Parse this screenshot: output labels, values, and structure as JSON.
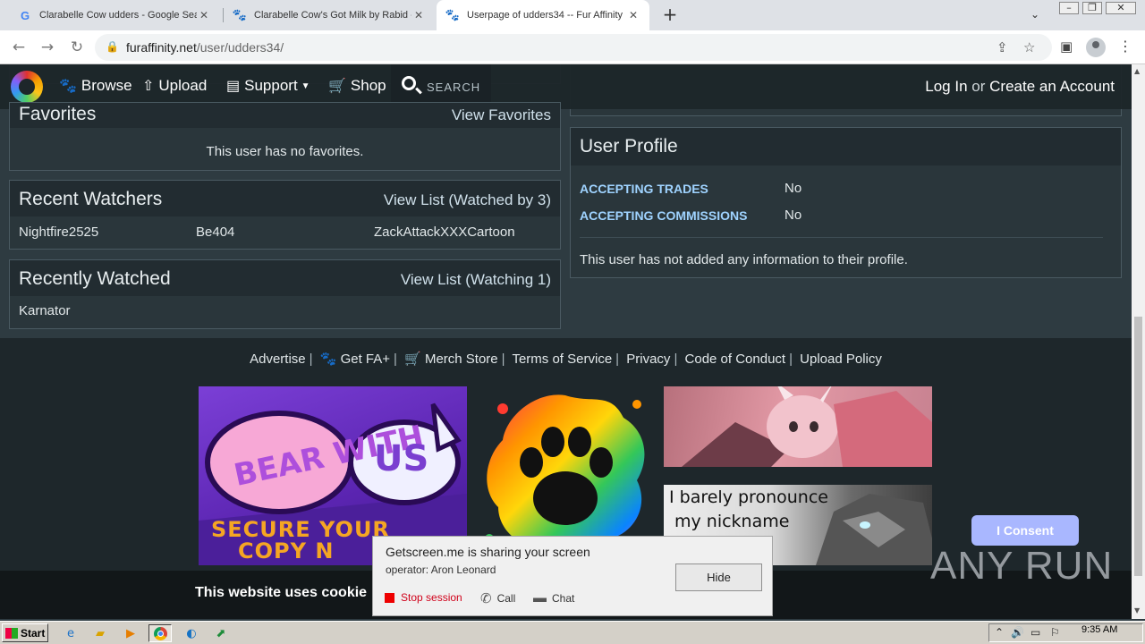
{
  "browser": {
    "tabs": [
      {
        "title": "Clarabelle Cow udders - Google Sear",
        "icon": "google-icon"
      },
      {
        "title": "Clarabelle Cow's Got Milk by Rabid --",
        "icon": "paw-icon"
      },
      {
        "title": "Userpage of udders34 -- Fur Affinity",
        "icon": "paw-icon"
      }
    ],
    "url_host": "furaffinity.net",
    "url_path": "/user/udders34/"
  },
  "nav": {
    "browse": "Browse",
    "upload": "Upload",
    "support": "Support",
    "shop": "Shop",
    "search": "SEARCH",
    "login": "Log In",
    "or": "or",
    "create": "Create an Account"
  },
  "favorites": {
    "title": "Favorites",
    "link": "View Favorites",
    "empty": "This user has no favorites."
  },
  "recent_watchers": {
    "title": "Recent Watchers",
    "link": "View List (Watched by 3)",
    "users": [
      "Nightfire2525",
      "Be404",
      "ZackAttackXXXCartoon"
    ]
  },
  "recently_watched": {
    "title": "Recently Watched",
    "link": "View List (Watching 1)",
    "users": [
      "Karnator"
    ]
  },
  "user_profile": {
    "title": "User Profile",
    "rows": [
      {
        "label": "ACCEPTING TRADES",
        "value": "No"
      },
      {
        "label": "ACCEPTING COMMISSIONS",
        "value": "No"
      }
    ],
    "info": "This user has not added any information to their profile."
  },
  "footer": {
    "links": [
      "Advertise",
      "Get FA+",
      "Merch Store",
      "Terms of Service",
      "Privacy",
      "Code of Conduct",
      "Upload Policy"
    ],
    "banner_bear": [
      "BEAR",
      "WITH",
      "US",
      "SECURE YOUR",
      "COPY N"
    ],
    "banner_nickname": [
      "I barely pronounce",
      "my nickname"
    ]
  },
  "cookie": {
    "text": "This website uses cookie",
    "consent": "I Consent"
  },
  "getscreen": {
    "title": "Getscreen.me is sharing your screen",
    "operator": "operator: Aron Leonard",
    "hide": "Hide",
    "stop": "Stop session",
    "call": "Call",
    "chat": "Chat"
  },
  "watermark": "ANY RUN",
  "taskbar": {
    "start": "Start",
    "clock": "9:35 AM"
  }
}
